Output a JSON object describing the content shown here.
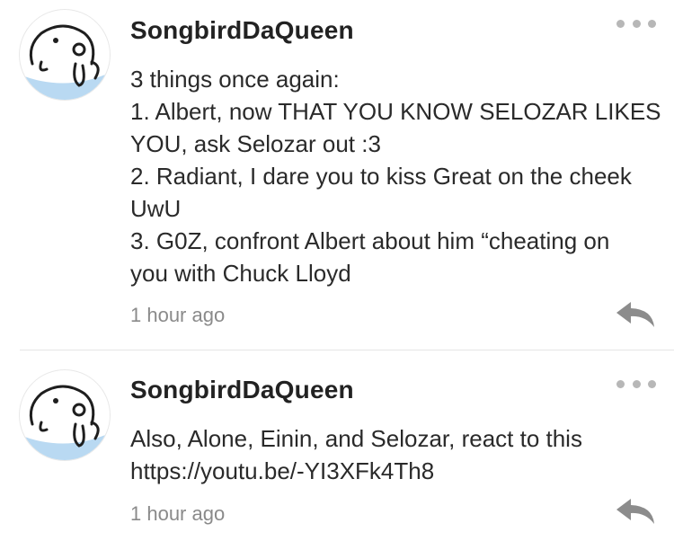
{
  "comments": [
    {
      "username": "SongbirdDaQueen",
      "lines": [
        "3 things once again:",
        "1. Albert, now THAT YOU KNOW SELOZAR LIKES",
        "YOU, ask Selozar out :3",
        "2. Radiant, I dare you to kiss Great on the cheek",
        "UwU",
        "3. G0Z, confront Albert about him “cheating on",
        "you with Chuck Lloyd"
      ],
      "timestamp": "1 hour ago",
      "avatar_icon": "doodle-face-avatar",
      "more_icon": "more-dots-icon",
      "reply_icon": "reply-arrow-icon"
    },
    {
      "username": "SongbirdDaQueen",
      "lines": [
        "Also, Alone, Einin, and Selozar, react to this",
        "https://youtu.be/-YI3XFk4Th8"
      ],
      "timestamp": "1 hour ago",
      "avatar_icon": "doodle-face-avatar",
      "more_icon": "more-dots-icon",
      "reply_icon": "reply-arrow-icon"
    }
  ],
  "colors": {
    "avatar_accent": "#b9d9f2",
    "icon_gray": "#8c8c8c",
    "divider": "#e6e6e6"
  }
}
